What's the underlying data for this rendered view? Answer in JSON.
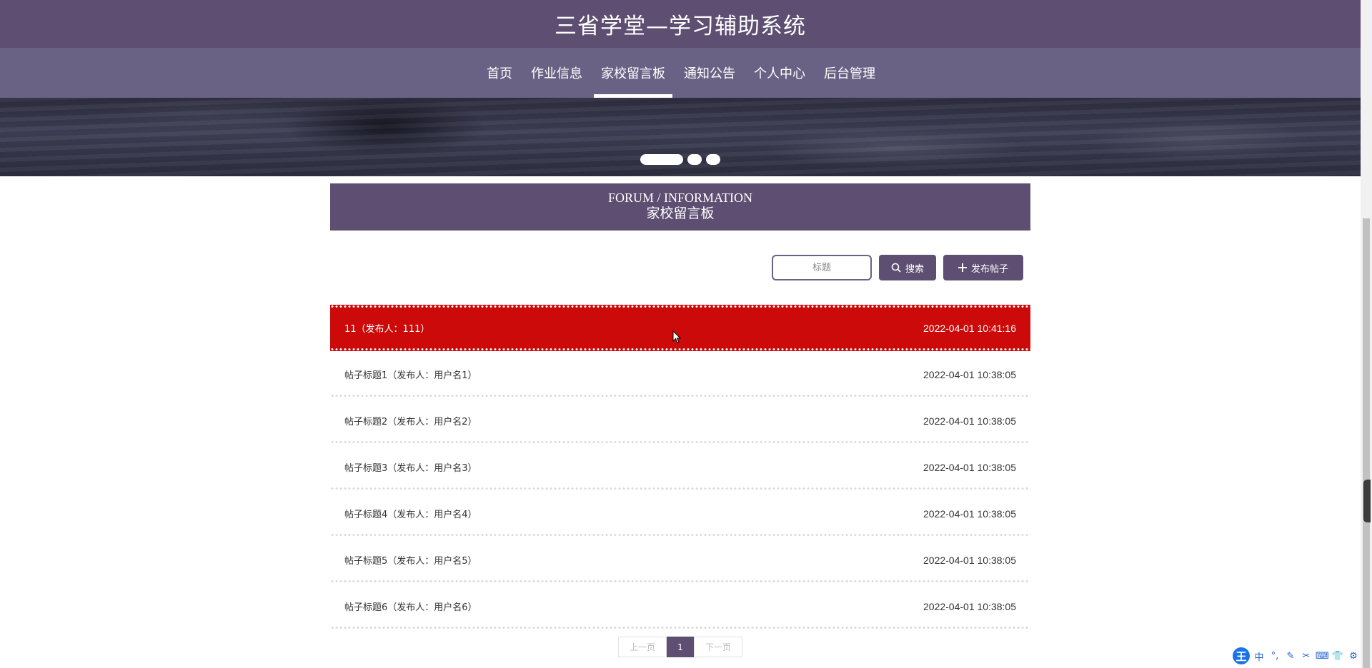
{
  "header": {
    "site_title": "三省学堂—学习辅助系统",
    "nav": [
      {
        "label": "首页",
        "active": false
      },
      {
        "label": "作业信息",
        "active": false
      },
      {
        "label": "家校留言板",
        "active": true
      },
      {
        "label": "通知公告",
        "active": false
      },
      {
        "label": "个人中心",
        "active": false
      },
      {
        "label": "后台管理",
        "active": false
      }
    ]
  },
  "banner": {
    "slide_count": 3,
    "active_slide": 1
  },
  "section": {
    "title_en": "FORUM / INFORMATION",
    "title_cn": "家校留言板"
  },
  "search": {
    "placeholder": "标题",
    "search_label": "搜索",
    "publish_label": "发布帖子",
    "search_icon": "search-icon",
    "publish_icon": "plus-icon"
  },
  "posts": [
    {
      "title": "11（发布人：111）",
      "date": "2022-04-01 10:41:16",
      "highlighted": true
    },
    {
      "title": "帖子标题1（发布人：用户名1）",
      "date": "2022-04-01 10:38:05",
      "highlighted": false
    },
    {
      "title": "帖子标题2（发布人：用户名2）",
      "date": "2022-04-01 10:38:05",
      "highlighted": false
    },
    {
      "title": "帖子标题3（发布人：用户名3）",
      "date": "2022-04-01 10:38:05",
      "highlighted": false
    },
    {
      "title": "帖子标题4（发布人：用户名4）",
      "date": "2022-04-01 10:38:05",
      "highlighted": false
    },
    {
      "title": "帖子标题5（发布人：用户名5）",
      "date": "2022-04-01 10:38:05",
      "highlighted": false
    },
    {
      "title": "帖子标题6（发布人：用户名6）",
      "date": "2022-04-01 10:38:05",
      "highlighted": false
    }
  ],
  "pagination": {
    "prev_label": "上一页",
    "current_page": "1",
    "next_label": "下一页"
  },
  "ime_toolbar": {
    "logo": "王",
    "items": [
      {
        "label": "中",
        "icon": "chinese-mode-icon"
      },
      {
        "label": "°,",
        "icon": "punctuation-icon"
      },
      {
        "label": "✎",
        "icon": "pen-icon"
      },
      {
        "label": "✂",
        "icon": "scissors-icon"
      },
      {
        "label": "⌨",
        "icon": "keyboard-icon"
      },
      {
        "label": "👕",
        "icon": "skin-icon"
      },
      {
        "label": "⚙",
        "icon": "gear-icon"
      }
    ]
  },
  "colors": {
    "primary": "#5d4e72",
    "nav_bg": "#6a6284",
    "highlight": "#cc0a0a"
  }
}
